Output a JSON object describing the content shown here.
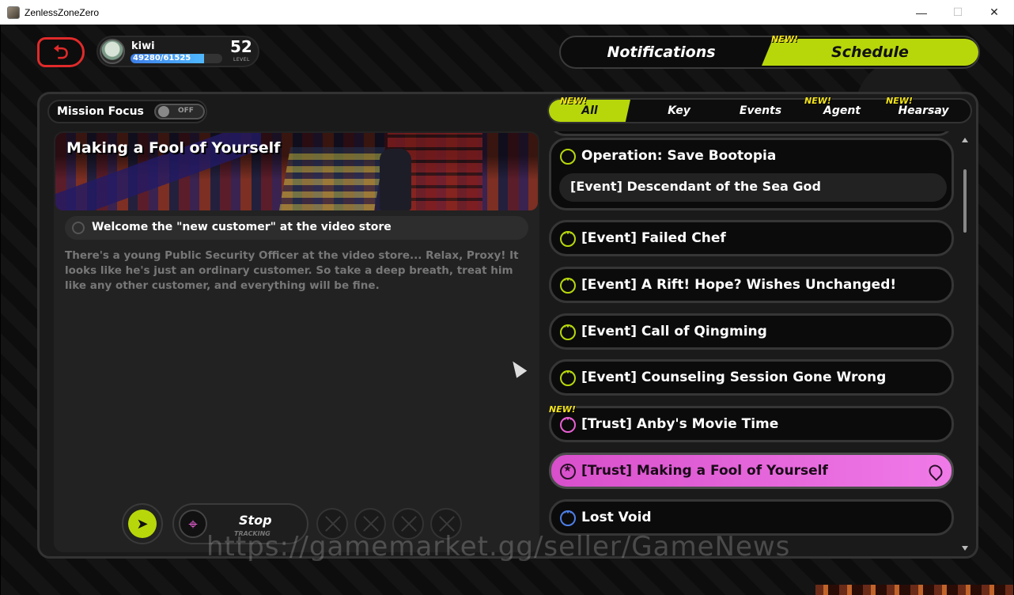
{
  "window": {
    "title": "ZenlessZoneZero",
    "minimize": "—",
    "maximize": "☐",
    "close": "✕"
  },
  "player": {
    "name": "kiwi",
    "xp_text": "49280/61525",
    "xp_current": 49280,
    "xp_max": 61525,
    "level": "52",
    "level_label": "LEVEL"
  },
  "top_switch": {
    "notifications": "Notifications",
    "schedule": "Schedule",
    "schedule_new": "NEW!",
    "active": "Schedule"
  },
  "mission_focus": {
    "label": "Mission Focus",
    "toggle_state": "OFF"
  },
  "tabs": [
    {
      "label": "All",
      "new": "NEW!",
      "active": true
    },
    {
      "label": "Key",
      "new": "",
      "active": false
    },
    {
      "label": "Events",
      "new": "",
      "active": false
    },
    {
      "label": "Agent",
      "new": "NEW!",
      "active": false
    },
    {
      "label": "Hearsay",
      "new": "NEW!",
      "active": false
    }
  ],
  "detail": {
    "title": "Making a Fool of Yourself",
    "objective": "Welcome the \"new customer\" at the video store",
    "description": "There's a young Public Security Officer at the video store... Relax, Proxy! It looks like he's just an ordinary customer. So take a deep breath, treat him like any other customer, and everything will be fine."
  },
  "tracking": {
    "label": "Stop",
    "sub": "TRACKING"
  },
  "missions": {
    "group": {
      "title": "Operation: Save Bootopia",
      "sub": "[Event] Descendant of the Sea God"
    },
    "items": [
      {
        "label": "[Event] Failed Chef",
        "color": "#b8d70b"
      },
      {
        "label": "[Event] A Rift! Hope? Wishes Unchanged!",
        "color": "#b8d70b"
      },
      {
        "label": "[Event] Call of Qingming",
        "color": "#b8d70b"
      },
      {
        "label": "[Event] Counseling Session Gone Wrong",
        "color": "#b8d70b"
      },
      {
        "label": "[Trust] Anby's Movie Time",
        "color": "#e85fd4",
        "new": "NEW!"
      },
      {
        "label": "[Trust] Making a Fool of Yourself",
        "color": "#e85fd4",
        "selected": true
      },
      {
        "label": "Lost Void",
        "color": "#4d7fe8"
      }
    ]
  },
  "watermark": "https://gamemarket.gg/seller/GameNews",
  "icons": {
    "back": "back-arrow-icon",
    "telegram": "paper-plane-icon",
    "track": "map-pin-icon"
  }
}
